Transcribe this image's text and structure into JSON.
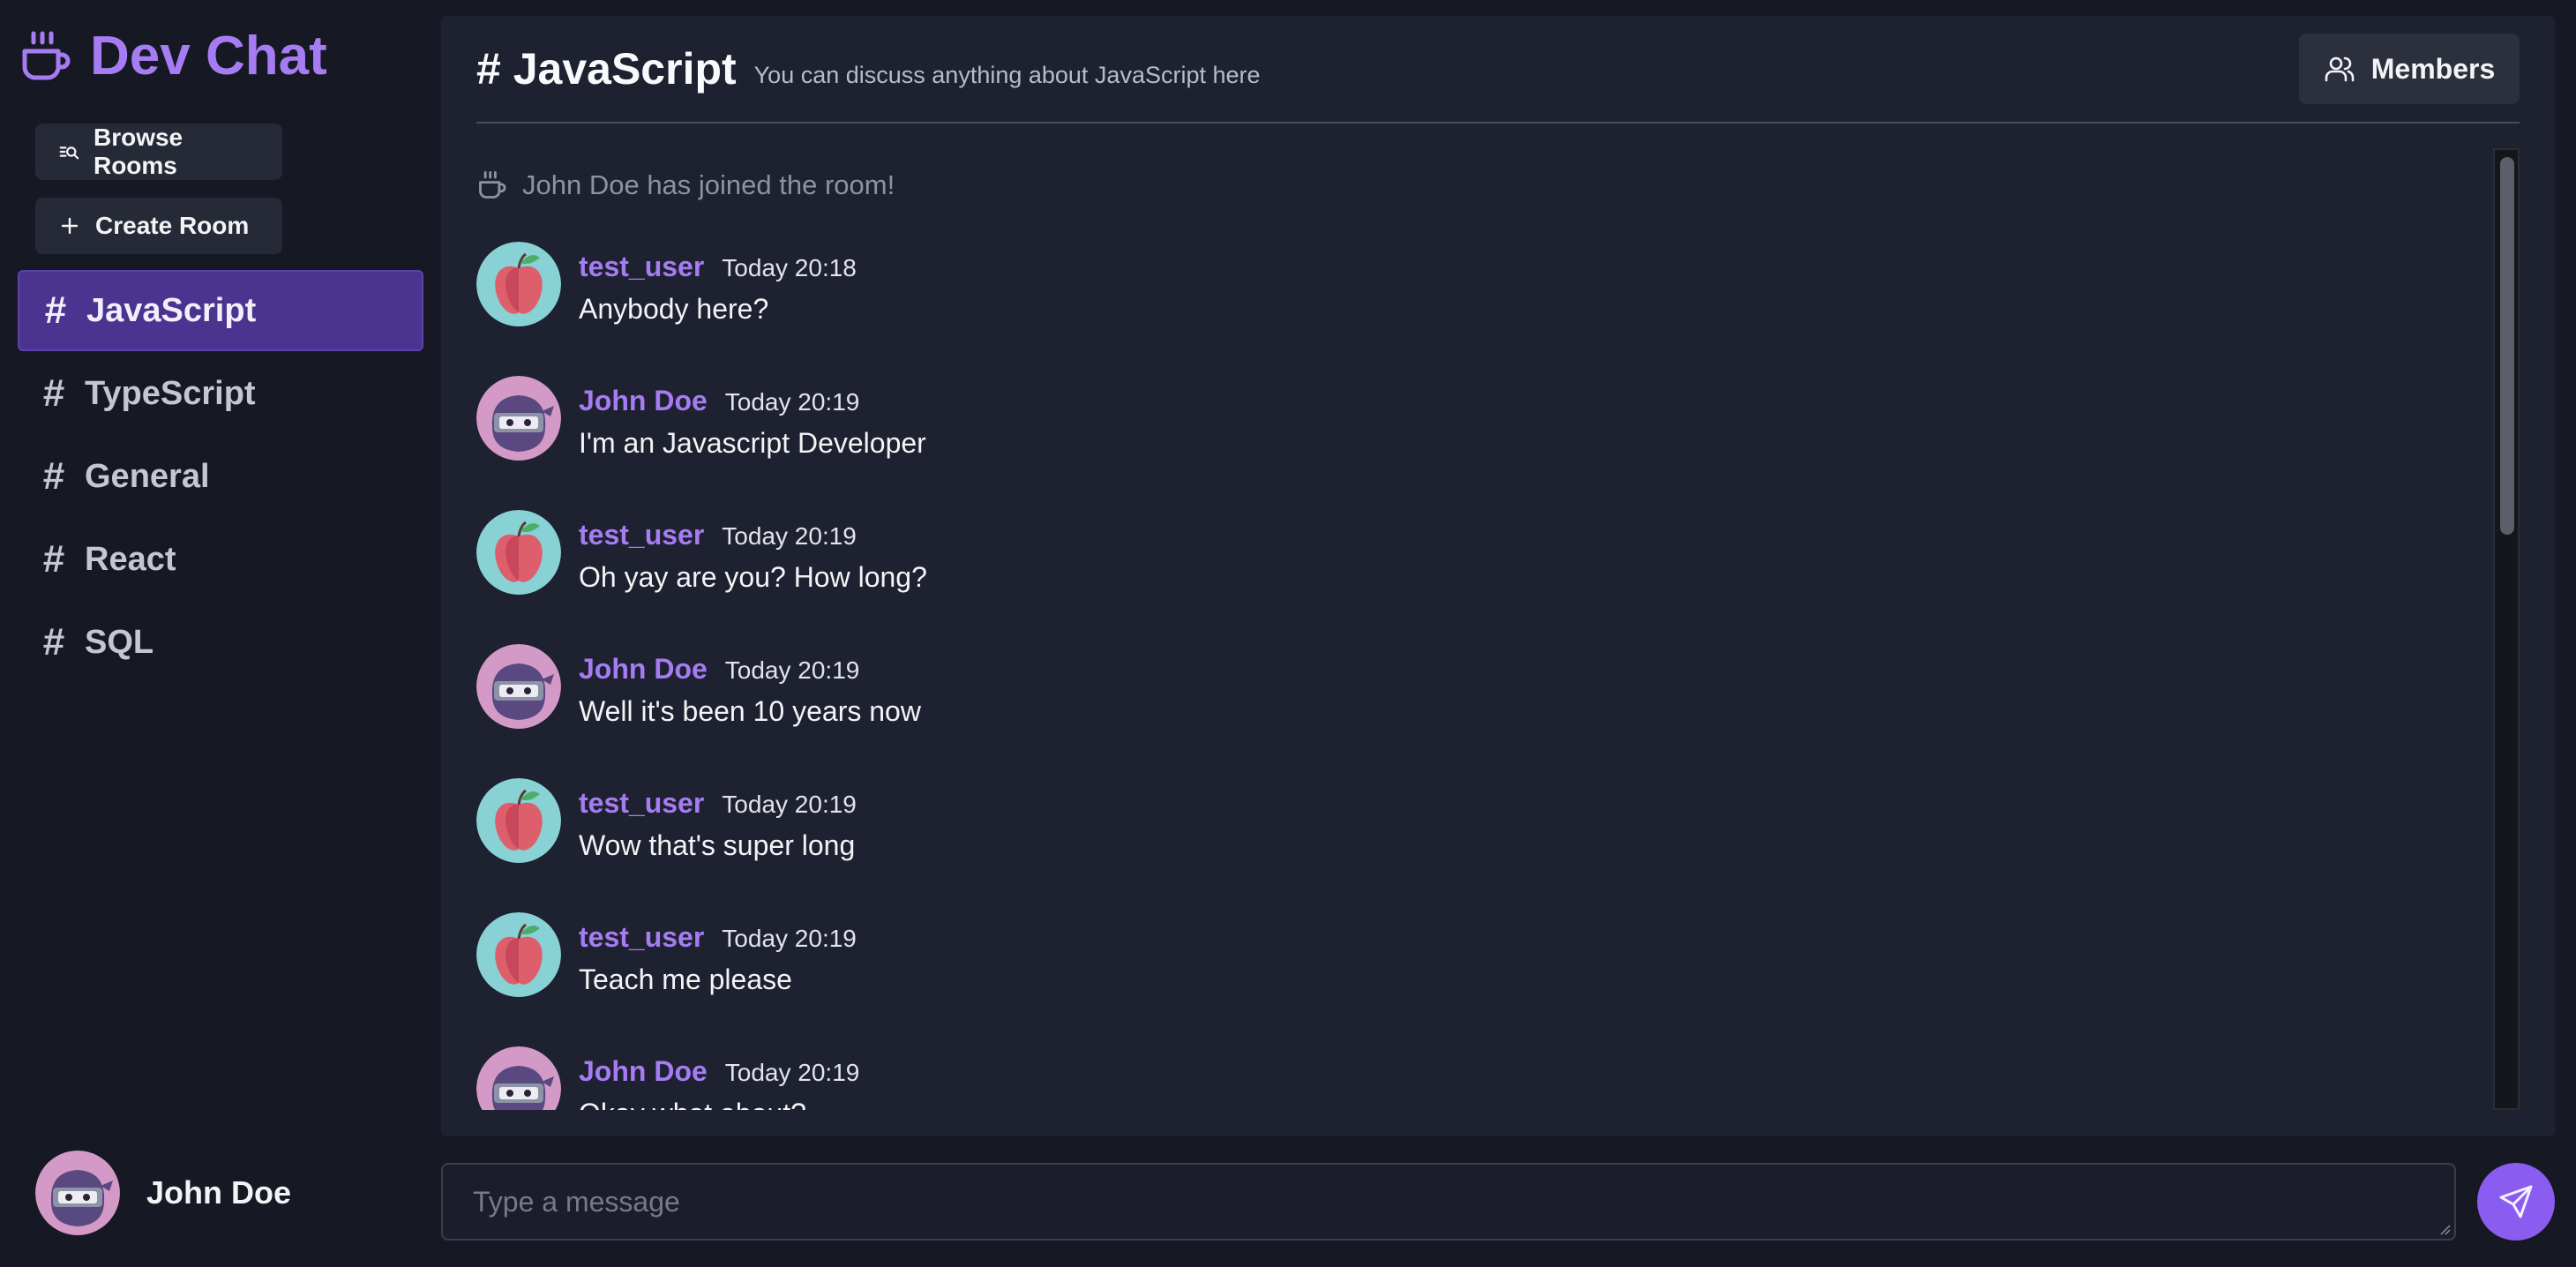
{
  "brand": {
    "title": "Dev Chat",
    "icon": "coffee-cup-icon",
    "accent": "#a57cf2"
  },
  "sidebar": {
    "browse_label": "Browse Rooms",
    "create_label": "Create Room",
    "rooms": [
      {
        "name": "JavaScript",
        "active": true
      },
      {
        "name": "TypeScript",
        "active": false
      },
      {
        "name": "General",
        "active": false
      },
      {
        "name": "React",
        "active": false
      },
      {
        "name": "SQL",
        "active": false
      }
    ],
    "current_user": {
      "name": "John Doe",
      "avatar": "ninja-avatar"
    }
  },
  "header": {
    "hash": "#",
    "room_title": "JavaScript",
    "room_description": "You can discuss anything about JavaScript here",
    "members_label": "Members"
  },
  "feed": {
    "system_message": "John Doe has joined the room!",
    "messages": [
      {
        "author": "test_user",
        "time": "Today 20:18",
        "text": "Anybody here?",
        "avatar": "apple-avatar"
      },
      {
        "author": "John Doe",
        "time": "Today 20:19",
        "text": "I'm an Javascript Developer",
        "avatar": "ninja-avatar"
      },
      {
        "author": "test_user",
        "time": "Today 20:19",
        "text": "Oh yay are you? How long?",
        "avatar": "apple-avatar"
      },
      {
        "author": "John Doe",
        "time": "Today 20:19",
        "text": "Well it's been 10 years now",
        "avatar": "ninja-avatar"
      },
      {
        "author": "test_user",
        "time": "Today 20:19",
        "text": "Wow that's super long",
        "avatar": "apple-avatar"
      },
      {
        "author": "test_user",
        "time": "Today 20:19",
        "text": "Teach me please",
        "avatar": "apple-avatar"
      },
      {
        "author": "John Doe",
        "time": "Today 20:19",
        "text": "Okay what about?",
        "avatar": "ninja-avatar"
      }
    ]
  },
  "composer": {
    "placeholder": "Type a message",
    "value": "",
    "send_icon": "send-icon"
  },
  "colors": {
    "background": "#161823",
    "panel": "#1e2130",
    "active_room": "#4b3390",
    "send_button": "#8a5cf0"
  }
}
